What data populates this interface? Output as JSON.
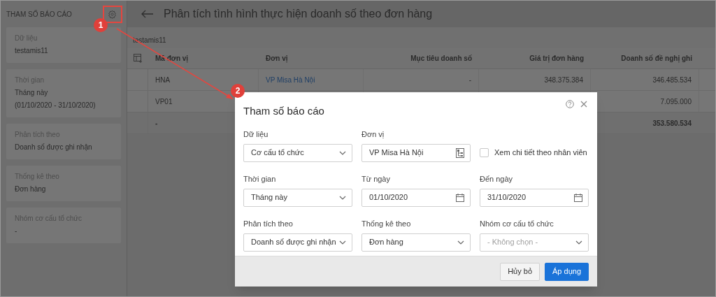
{
  "sidebar": {
    "title": "THAM SỐ BÁO CÁO",
    "cards": [
      {
        "label": "Dữ liệu",
        "values": [
          "testamis11"
        ]
      },
      {
        "label": "Thời gian",
        "values": [
          "Tháng này",
          "(01/10/2020 - 31/10/2020)"
        ]
      },
      {
        "label": "Phân tích theo",
        "values": [
          "Doanh số được ghi nhận"
        ]
      },
      {
        "label": "Thống kê theo",
        "values": [
          "Đơn hàng"
        ]
      },
      {
        "label": "Nhóm cơ cấu tổ chức",
        "values": [
          "-"
        ]
      }
    ]
  },
  "page": {
    "title": "Phân tích tình hình thực hiện doanh số theo đơn hàng",
    "subtitle": "testamis11"
  },
  "table": {
    "columns": [
      "Mã đơn vị",
      "Đơn vị",
      "Mục tiêu doanh số",
      "Giá trị đơn hàng",
      "Doanh số đề nghị ghi"
    ],
    "rows": [
      {
        "kind": "data",
        "cells": [
          "HNA",
          "VP Misa Hà Nội",
          "-",
          "348.375.384",
          "346.485.534"
        ]
      },
      {
        "kind": "data",
        "cells": [
          "VP01",
          null,
          null,
          null,
          "7.095.000"
        ]
      },
      {
        "kind": "total",
        "cells": [
          "-",
          null,
          null,
          null,
          "353.580.534"
        ]
      }
    ]
  },
  "dialog": {
    "title": "Tham số báo cáo",
    "fields": [
      {
        "kind": "select",
        "label": "Dữ liệu",
        "value": "Cơ cấu tổ chức"
      },
      {
        "kind": "picker",
        "label": "Đơn vị",
        "value": "VP Misa Hà Nội"
      },
      {
        "kind": "checkbox",
        "text": "Xem chi tiết theo nhân viên",
        "checked": false
      },
      {
        "kind": "select",
        "label": "Thời gian",
        "value": "Tháng này"
      },
      {
        "kind": "date",
        "label": "Từ ngày",
        "value": "01/10/2020"
      },
      {
        "kind": "date",
        "label": "Đến ngày",
        "value": "31/10/2020"
      },
      {
        "kind": "select",
        "label": "Phân tích theo",
        "value": "Doanh số được ghi nhận"
      },
      {
        "kind": "select",
        "label": "Thống kê theo",
        "value": "Đơn hàng"
      },
      {
        "kind": "select",
        "label": "Nhóm cơ cấu tổ chức",
        "placeholder": "- Không chọn -"
      }
    ],
    "buttons": [
      {
        "label": "Hủy bỏ",
        "primary": false
      },
      {
        "label": "Áp dụng",
        "primary": true
      }
    ]
  },
  "annotations": [
    {
      "label": "1"
    },
    {
      "label": "2"
    }
  ]
}
